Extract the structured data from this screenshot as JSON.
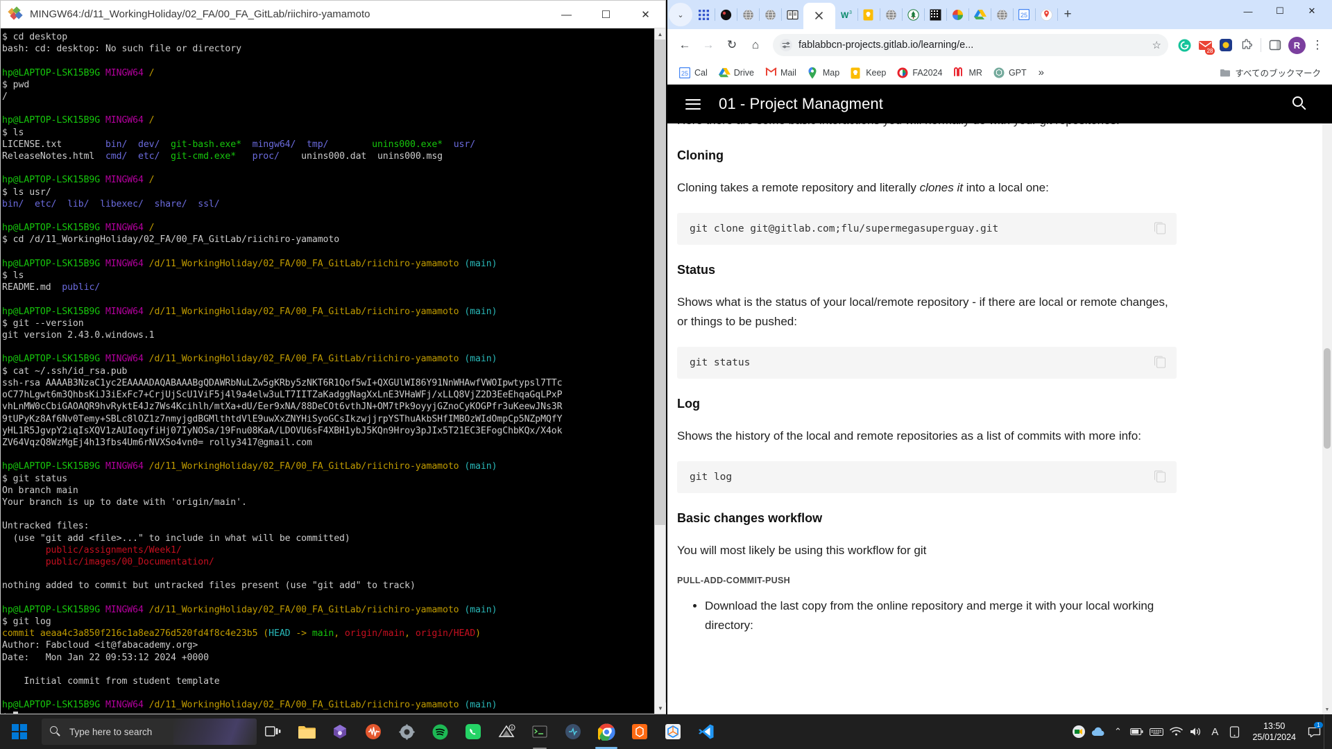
{
  "terminal": {
    "title": "MINGW64:/d/11_WorkingHoliday/02_FA/00_FA_GitLab/riichiro-yamamoto",
    "window_buttons": {
      "minimize": "—",
      "maximize": "☐",
      "close": "✕"
    },
    "prompt_user": "hp@LAPTOP-LSK15B9G",
    "prompt_shell": "MINGW64",
    "lines": [
      {
        "segments": [
          {
            "t": "$ cd desktop",
            "c": "c-white"
          }
        ]
      },
      {
        "segments": [
          {
            "t": "bash: cd: desktop: No such file or directory",
            "c": "c-white"
          }
        ]
      },
      {
        "segments": [
          {
            "t": "",
            "c": "c-white"
          }
        ]
      },
      {
        "segments": [
          {
            "t": "hp@LAPTOP-LSK15B9G ",
            "c": "c-green"
          },
          {
            "t": "MINGW64 ",
            "c": "c-purple"
          },
          {
            "t": "/",
            "c": "c-yellow"
          }
        ]
      },
      {
        "segments": [
          {
            "t": "$ pwd",
            "c": "c-white"
          }
        ]
      },
      {
        "segments": [
          {
            "t": "/",
            "c": "c-white"
          }
        ]
      },
      {
        "segments": [
          {
            "t": "",
            "c": "c-white"
          }
        ]
      },
      {
        "segments": [
          {
            "t": "hp@LAPTOP-LSK15B9G ",
            "c": "c-green"
          },
          {
            "t": "MINGW64 ",
            "c": "c-purple"
          },
          {
            "t": "/",
            "c": "c-yellow"
          }
        ]
      },
      {
        "segments": [
          {
            "t": "$ ls",
            "c": "c-white"
          }
        ]
      },
      {
        "segments": [
          {
            "t": "LICENSE.txt        ",
            "c": "c-white"
          },
          {
            "t": "bin/  dev/  ",
            "c": "c-blue"
          },
          {
            "t": "git-bash.exe*  ",
            "c": "c-lgreen"
          },
          {
            "t": "mingw64/  tmp/",
            "c": "c-blue"
          },
          {
            "t": "        ",
            "c": "c-white"
          },
          {
            "t": "unins000.exe*  ",
            "c": "c-lgreen"
          },
          {
            "t": "usr/",
            "c": "c-blue"
          }
        ]
      },
      {
        "segments": [
          {
            "t": "ReleaseNotes.html  ",
            "c": "c-white"
          },
          {
            "t": "cmd/  etc/  ",
            "c": "c-blue"
          },
          {
            "t": "git-cmd.exe*   ",
            "c": "c-lgreen"
          },
          {
            "t": "proc/",
            "c": "c-blue"
          },
          {
            "t": "    unins000.dat  unins000.msg",
            "c": "c-white"
          }
        ]
      },
      {
        "segments": [
          {
            "t": "",
            "c": "c-white"
          }
        ]
      },
      {
        "segments": [
          {
            "t": "hp@LAPTOP-LSK15B9G ",
            "c": "c-green"
          },
          {
            "t": "MINGW64 ",
            "c": "c-purple"
          },
          {
            "t": "/",
            "c": "c-yellow"
          }
        ]
      },
      {
        "segments": [
          {
            "t": "$ ls usr/",
            "c": "c-white"
          }
        ]
      },
      {
        "segments": [
          {
            "t": "bin/  etc/  lib/  libexec/  share/  ssl/",
            "c": "c-blue"
          }
        ]
      },
      {
        "segments": [
          {
            "t": "",
            "c": "c-white"
          }
        ]
      },
      {
        "segments": [
          {
            "t": "hp@LAPTOP-LSK15B9G ",
            "c": "c-green"
          },
          {
            "t": "MINGW64 ",
            "c": "c-purple"
          },
          {
            "t": "/",
            "c": "c-yellow"
          }
        ]
      },
      {
        "segments": [
          {
            "t": "$ cd /d/11_WorkingHoliday/02_FA/00_FA_GitLab/riichiro-yamamoto",
            "c": "c-white"
          }
        ]
      },
      {
        "segments": [
          {
            "t": "",
            "c": "c-white"
          }
        ]
      },
      {
        "segments": [
          {
            "t": "hp@LAPTOP-LSK15B9G ",
            "c": "c-green"
          },
          {
            "t": "MINGW64 ",
            "c": "c-purple"
          },
          {
            "t": "/d/11_WorkingHoliday/02_FA/00_FA_GitLab/riichiro-yamamoto ",
            "c": "c-yellow"
          },
          {
            "t": "(main)",
            "c": "c-cyanb"
          }
        ]
      },
      {
        "segments": [
          {
            "t": "$ ls",
            "c": "c-white"
          }
        ]
      },
      {
        "segments": [
          {
            "t": "README.md  ",
            "c": "c-white"
          },
          {
            "t": "public/",
            "c": "c-blue"
          }
        ]
      },
      {
        "segments": [
          {
            "t": "",
            "c": "c-white"
          }
        ]
      },
      {
        "segments": [
          {
            "t": "hp@LAPTOP-LSK15B9G ",
            "c": "c-green"
          },
          {
            "t": "MINGW64 ",
            "c": "c-purple"
          },
          {
            "t": "/d/11_WorkingHoliday/02_FA/00_FA_GitLab/riichiro-yamamoto ",
            "c": "c-yellow"
          },
          {
            "t": "(main)",
            "c": "c-cyanb"
          }
        ]
      },
      {
        "segments": [
          {
            "t": "$ git --version",
            "c": "c-white"
          }
        ]
      },
      {
        "segments": [
          {
            "t": "git version 2.43.0.windows.1",
            "c": "c-white"
          }
        ]
      },
      {
        "segments": [
          {
            "t": "",
            "c": "c-white"
          }
        ]
      },
      {
        "segments": [
          {
            "t": "hp@LAPTOP-LSK15B9G ",
            "c": "c-green"
          },
          {
            "t": "MINGW64 ",
            "c": "c-purple"
          },
          {
            "t": "/d/11_WorkingHoliday/02_FA/00_FA_GitLab/riichiro-yamamoto ",
            "c": "c-yellow"
          },
          {
            "t": "(main)",
            "c": "c-cyanb"
          }
        ]
      },
      {
        "segments": [
          {
            "t": "$ cat ~/.ssh/id_rsa.pub",
            "c": "c-white"
          }
        ]
      },
      {
        "segments": [
          {
            "t": "ssh-rsa AAAAB3NzaC1yc2EAAAADAQABAAABgQDAWRbNuLZw5gKRby5zNKT6R1Qof5wI+QXGUlWI86Y91NnWHAwfVWOIpwtypsl7TTc",
            "c": "c-white"
          }
        ]
      },
      {
        "segments": [
          {
            "t": "oC77hLgwt6m3QhbsKiJ3iExFc7+CrjUjScU1ViF5j4l9a4elw3uLT7IITZaKadggNagXxLnE3VHaWFj/xLLQ8VjZ2D3EeEhqaGqLPxP",
            "c": "c-white"
          }
        ]
      },
      {
        "segments": [
          {
            "t": "vhLnMW0cCbiGAOAQR9hvRyktE4Jz7Ws4Kcihlh/mtXa+dU/Eer9xNA/88DeCOt6vthJN+OM7tPk9oyyjGZnoCyKOGPfr3uKeewJNs3R",
            "c": "c-white"
          }
        ]
      },
      {
        "segments": [
          {
            "t": "9tUPyKz8Af6Nv0Temy+SBLc8lOZ1z7nmyjgdBGMlthtdVlE9uwXxZNYHiSyoGCsIkzwjjrpYSThuAkbSHfIMBOzWIdOmpCp5NZpMQfY",
            "c": "c-white"
          }
        ]
      },
      {
        "segments": [
          {
            "t": "yHL1R5JgvpY2iqIsXQV1zAUIoqyfiHj07IyNOSa/19Fnu08KaA/LDOVU6sF4XBH1ybJ5KQn9Hroy3pJIx5T21EC3EFogChbKQx/X4ok",
            "c": "c-white"
          }
        ]
      },
      {
        "segments": [
          {
            "t": "ZV64VqzQ8WzMgEj4h13fbs4Um6rNVXSo4vn0= rolly3417@gmail.com",
            "c": "c-white"
          }
        ]
      },
      {
        "segments": [
          {
            "t": "",
            "c": "c-white"
          }
        ]
      },
      {
        "segments": [
          {
            "t": "hp@LAPTOP-LSK15B9G ",
            "c": "c-green"
          },
          {
            "t": "MINGW64 ",
            "c": "c-purple"
          },
          {
            "t": "/d/11_WorkingHoliday/02_FA/00_FA_GitLab/riichiro-yamamoto ",
            "c": "c-yellow"
          },
          {
            "t": "(main)",
            "c": "c-cyanb"
          }
        ]
      },
      {
        "segments": [
          {
            "t": "$ git status",
            "c": "c-white"
          }
        ]
      },
      {
        "segments": [
          {
            "t": "On branch main",
            "c": "c-white"
          }
        ]
      },
      {
        "segments": [
          {
            "t": "Your branch is up to date with 'origin/main'.",
            "c": "c-white"
          }
        ]
      },
      {
        "segments": [
          {
            "t": "",
            "c": "c-white"
          }
        ]
      },
      {
        "segments": [
          {
            "t": "Untracked files:",
            "c": "c-white"
          }
        ]
      },
      {
        "segments": [
          {
            "t": "  (use \"git add <file>...\" to include in what will be committed)",
            "c": "c-white"
          }
        ]
      },
      {
        "segments": [
          {
            "t": "        public/assignments/Week1/",
            "c": "c-red"
          }
        ]
      },
      {
        "segments": [
          {
            "t": "        public/images/00_Documentation/",
            "c": "c-red"
          }
        ]
      },
      {
        "segments": [
          {
            "t": "",
            "c": "c-white"
          }
        ]
      },
      {
        "segments": [
          {
            "t": "nothing added to commit but untracked files present (use \"git add\" to track)",
            "c": "c-white"
          }
        ]
      },
      {
        "segments": [
          {
            "t": "",
            "c": "c-white"
          }
        ]
      },
      {
        "segments": [
          {
            "t": "hp@LAPTOP-LSK15B9G ",
            "c": "c-green"
          },
          {
            "t": "MINGW64 ",
            "c": "c-purple"
          },
          {
            "t": "/d/11_WorkingHoliday/02_FA/00_FA_GitLab/riichiro-yamamoto ",
            "c": "c-yellow"
          },
          {
            "t": "(main)",
            "c": "c-cyanb"
          }
        ]
      },
      {
        "segments": [
          {
            "t": "$ git log",
            "c": "c-white"
          }
        ]
      },
      {
        "segments": [
          {
            "t": "commit aeaa4c3a850f216c1a8ea276d520fd4f8c4e23b5 (",
            "c": "c-yellow"
          },
          {
            "t": "HEAD",
            "c": "c-cyanb"
          },
          {
            "t": " -> ",
            "c": "c-yellow"
          },
          {
            "t": "main",
            "c": "c-lgreen"
          },
          {
            "t": ", ",
            "c": "c-yellow"
          },
          {
            "t": "origin/main",
            "c": "c-red"
          },
          {
            "t": ", ",
            "c": "c-yellow"
          },
          {
            "t": "origin/HEAD",
            "c": "c-red"
          },
          {
            "t": ")",
            "c": "c-yellow"
          }
        ]
      },
      {
        "segments": [
          {
            "t": "Author: Fabcloud <it@fabacademy.org>",
            "c": "c-white"
          }
        ]
      },
      {
        "segments": [
          {
            "t": "Date:   Mon Jan 22 09:53:12 2024 +0000",
            "c": "c-white"
          }
        ]
      },
      {
        "segments": [
          {
            "t": "",
            "c": "c-white"
          }
        ]
      },
      {
        "segments": [
          {
            "t": "    Initial commit from student template",
            "c": "c-white"
          }
        ]
      },
      {
        "segments": [
          {
            "t": "",
            "c": "c-white"
          }
        ]
      },
      {
        "segments": [
          {
            "t": "hp@LAPTOP-LSK15B9G ",
            "c": "c-green"
          },
          {
            "t": "MINGW64 ",
            "c": "c-purple"
          },
          {
            "t": "/d/11_WorkingHoliday/02_FA/00_FA_GitLab/riichiro-yamamoto ",
            "c": "c-yellow"
          },
          {
            "t": "(main)",
            "c": "c-cyanb"
          }
        ]
      }
    ],
    "final_prompt": "$ "
  },
  "chrome": {
    "window_buttons": {
      "minimize": "—",
      "maximize": "☐",
      "close": "✕"
    },
    "tab_list_chevron": "⌄",
    "new_tab_label": "+",
    "tabs": [
      {
        "name": "grid-tab",
        "icon": "grid-icon"
      },
      {
        "name": "dark-tab",
        "icon": "circle-dark-icon"
      },
      {
        "name": "globe-tab-1",
        "icon": "globe-icon"
      },
      {
        "name": "globe-tab-2",
        "icon": "globe-icon"
      },
      {
        "name": "book-tab",
        "icon": "book-icon"
      },
      {
        "name": "active-tab",
        "icon": "close-icon",
        "active": true
      },
      {
        "name": "w3-tab",
        "icon": "w3-icon"
      },
      {
        "name": "keep-tab",
        "icon": "keep-icon"
      },
      {
        "name": "globe-tab-3",
        "icon": "globe-icon"
      },
      {
        "name": "tree-tab",
        "icon": "tree-icon"
      },
      {
        "name": "film-tab",
        "icon": "film-icon"
      },
      {
        "name": "photos-tab",
        "icon": "photos-icon"
      },
      {
        "name": "drive-tab",
        "icon": "drive-icon"
      },
      {
        "name": "globe-tab-4",
        "icon": "globe-icon"
      },
      {
        "name": "calendar-tab",
        "icon": "calendar-icon"
      },
      {
        "name": "maps-tab",
        "icon": "maps-icon"
      }
    ],
    "toolbar": {
      "back": "←",
      "forward": "→",
      "reload": "↻",
      "home": "⌂",
      "url": "fablabbcn-projects.gitlab.io/learning/e...",
      "bookmark_star": "☆",
      "menu": "⋮",
      "profile_initial": "R",
      "extension_badge": "28"
    },
    "bookmarks": [
      {
        "label": "Cal",
        "icon": "calendar-icon"
      },
      {
        "label": "Drive",
        "icon": "drive-icon"
      },
      {
        "label": "Mail",
        "icon": "gmail-icon"
      },
      {
        "label": "Map",
        "icon": "maps-pin-icon"
      },
      {
        "label": "Keep",
        "icon": "keep-icon"
      },
      {
        "label": "FA2024",
        "icon": "fabacademy-icon"
      },
      {
        "label": "MR",
        "icon": "mr-icon"
      },
      {
        "label": "GPT",
        "icon": "chatgpt-icon"
      }
    ],
    "bookmarks_overflow": "»",
    "bookmarks_folder": "すべてのブックマーク"
  },
  "page": {
    "header_title": "01 - Project Managment",
    "menu_icon": "hamburger-icon",
    "search_icon": "search-icon",
    "blocks": [
      {
        "type": "p",
        "clipped": true,
        "text": "Here there are some basic interactions you will normally do with your git repositories:"
      },
      {
        "type": "h",
        "text": "Cloning"
      },
      {
        "type": "p",
        "text": "Cloning takes a remote repository and literally clones it into a local one:"
      },
      {
        "type": "code",
        "text": "git clone git@gitlab.com;flu/supermegasuperguay.git"
      },
      {
        "type": "h",
        "text": "Status"
      },
      {
        "type": "p",
        "text": "Shows what is the status of your local/remote repository - if there are local or remote changes, or things to be pushed:"
      },
      {
        "type": "code",
        "text": "git status"
      },
      {
        "type": "h",
        "text": "Log"
      },
      {
        "type": "p",
        "text": "Shows the history of the local and remote repositories as a list of commits with more info:"
      },
      {
        "type": "code",
        "text": "git log"
      },
      {
        "type": "h",
        "text": "Basic changes workflow"
      },
      {
        "type": "p",
        "text": "You will most likely be using this workflow for git"
      },
      {
        "type": "caption",
        "text": "PULL-ADD-COMMIT-PUSH"
      },
      {
        "type": "li",
        "text": "Download the last copy from the online repository and merge it with your local working directory:"
      }
    ]
  },
  "taskbar": {
    "start_icon": "windows-logo-icon",
    "search_placeholder": "Type here to search",
    "search_icon": "search-icon",
    "items": [
      {
        "name": "task-view",
        "icon": "task-view-icon"
      },
      {
        "name": "file-explorer",
        "icon": "folder-icon"
      },
      {
        "name": "store",
        "icon": "store-icon"
      },
      {
        "name": "audacity",
        "icon": "audacity-icon"
      },
      {
        "name": "settings",
        "icon": "gear-icon"
      },
      {
        "name": "spotify",
        "icon": "spotify-icon"
      },
      {
        "name": "whatsapp",
        "icon": "whatsapp-icon"
      },
      {
        "name": "autodesk",
        "icon": "autodesk-icon"
      },
      {
        "name": "git-bash",
        "icon": "git-bash-icon",
        "open": true
      },
      {
        "name": "kicad",
        "icon": "kicad-icon"
      },
      {
        "name": "chrome",
        "icon": "chrome-icon",
        "active": true
      },
      {
        "name": "prusa",
        "icon": "prusa-icon"
      },
      {
        "name": "fusion",
        "icon": "fusion-icon"
      },
      {
        "name": "vscode",
        "icon": "vscode-icon"
      }
    ],
    "tray": {
      "meet_icon": "meet-icon",
      "onedrive_icon": "cloud-icon",
      "chevron": "⌃",
      "icons": [
        "battery-icon",
        "keyboard-icon",
        "wifi-icon",
        "volume-icon"
      ],
      "language": "A",
      "tablet_icon": "tablet-icon",
      "time": "13:50",
      "date": "25/01/2024",
      "notification_icon": "notification-icon",
      "notification_count": "1"
    }
  }
}
